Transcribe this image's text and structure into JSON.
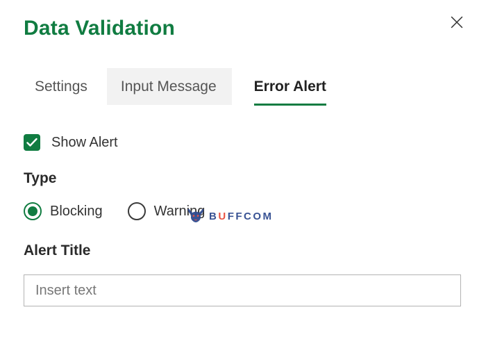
{
  "title": "Data Validation",
  "tabs": {
    "settings": "Settings",
    "input_message": "Input Message",
    "error_alert": "Error Alert"
  },
  "show_alert": {
    "label": "Show Alert",
    "checked": true
  },
  "type_section": {
    "label": "Type",
    "options": {
      "blocking": "Blocking",
      "warning": "Warning"
    },
    "selected": "blocking"
  },
  "alert_title": {
    "label": "Alert Title",
    "placeholder": "Insert text",
    "value": ""
  },
  "watermark": {
    "text_pre": "B",
    "text_u": "U",
    "text_post": "FFCOM"
  }
}
